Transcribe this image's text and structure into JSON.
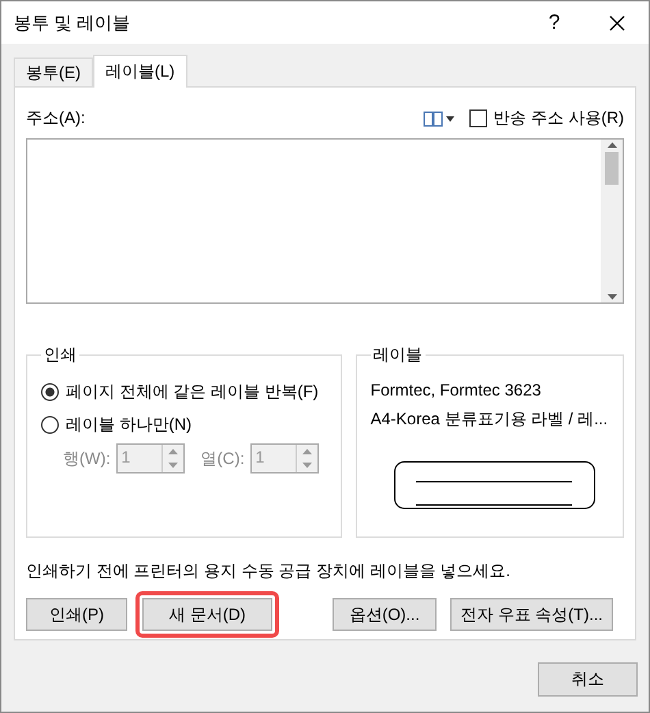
{
  "window": {
    "title": "봉투 및 레이블",
    "help": "?"
  },
  "tabs": [
    {
      "label": "봉투(E)",
      "selected": false
    },
    {
      "label": "레이블(L)",
      "selected": true
    }
  ],
  "address": {
    "label": "주소(A):",
    "return_address": {
      "label": "반송 주소 사용(R)",
      "checked": false
    }
  },
  "print": {
    "title": "인쇄",
    "options": [
      {
        "label": "페이지 전체에 같은 레이블 반복(F)",
        "selected": true
      },
      {
        "label": "레이블 하나만(N)",
        "selected": false
      }
    ],
    "row": {
      "label": "행(W):",
      "value": "1",
      "disabled": true
    },
    "column": {
      "label": "열(C):",
      "value": "1",
      "disabled": true
    }
  },
  "label": {
    "title": "레이블",
    "lines": [
      "Formtec, Formtec 3623",
      "A4-Korea 분류표기용 라벨 / 레..."
    ]
  },
  "note": "인쇄하기 전에 프린터의 용지 수동 공급 장치에 레이블을 넣으세요.",
  "buttons": [
    {
      "label": "인쇄(P)",
      "highlighted": false
    },
    {
      "label": "새 문서(D)",
      "highlighted": true
    },
    {
      "label": "옵션(O)...",
      "highlighted": false
    },
    {
      "label": "전자 우표 속성(T)...",
      "highlighted": false
    }
  ],
  "cancel": "취소"
}
